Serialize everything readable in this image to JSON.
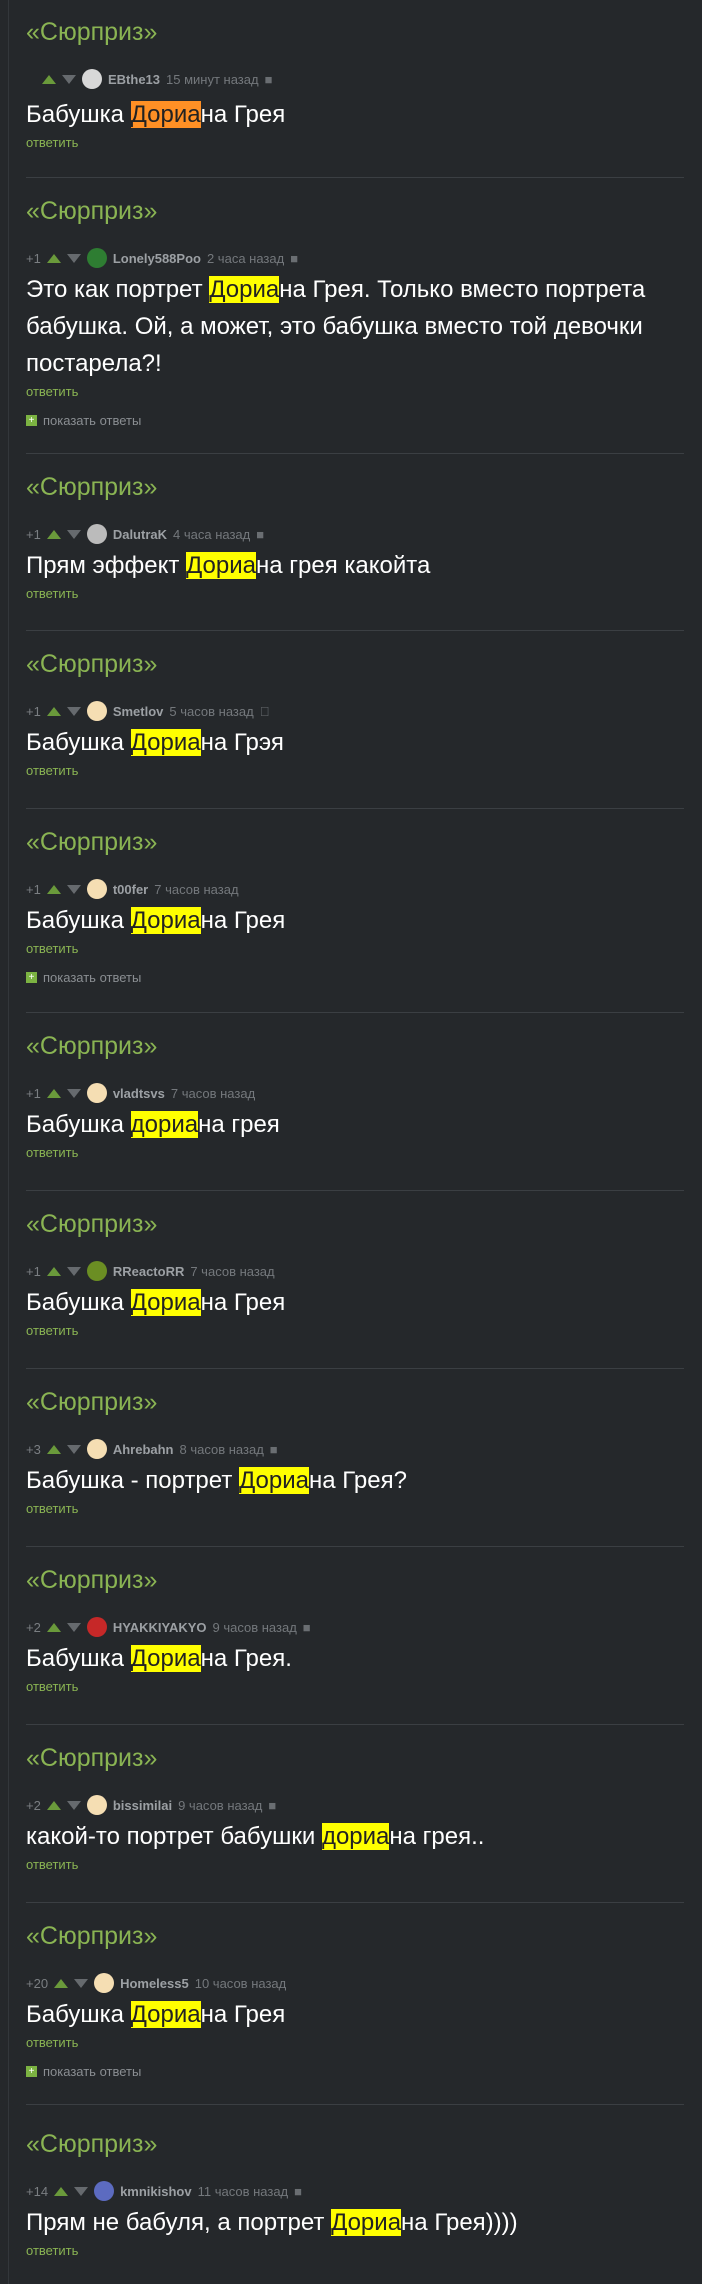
{
  "comments": [
    {
      "story": "«Сюрприз»",
      "rating": "",
      "author": "EBthe13",
      "time": "15 минут назад",
      "platform_icon": "android-icon",
      "pre": "Бабушка ",
      "hl": "Дориа",
      "post": "на Грея",
      "hl_color": "orange",
      "reply": "ответить",
      "show_replies": ""
    },
    {
      "story": "«Сюрприз»",
      "rating": "+1",
      "author": "Lonely588Poo",
      "time": "2 часа назад",
      "platform_icon": "android-icon",
      "pre": "Это как портрет ",
      "hl": "Дориа",
      "post": "на Грея. Только вместо портрета бабушка. Ой, а может, это бабушка вместо той девочки постарела?!",
      "hl_color": "yellow",
      "reply": "ответить",
      "show_replies": "показать ответы"
    },
    {
      "story": "«Сюрприз»",
      "rating": "+1",
      "author": "DalutraK",
      "time": "4 часа назад",
      "platform_icon": "android-icon",
      "pre": "Прям эффект ",
      "hl": "Дориа",
      "post": "на грея какойта",
      "hl_color": "yellow",
      "reply": "ответить",
      "show_replies": ""
    },
    {
      "story": "«Сюрприз»",
      "rating": "+1",
      "author": "Smetlov",
      "time": "5 часов назад",
      "platform_icon": "apple-icon",
      "pre": "Бабушка ",
      "hl": "Дориа",
      "post": "на Грэя",
      "hl_color": "yellow",
      "reply": "ответить",
      "show_replies": ""
    },
    {
      "story": "«Сюрприз»",
      "rating": "+1",
      "author": "t00fer",
      "time": "7 часов назад",
      "platform_icon": "",
      "pre": "Бабушка ",
      "hl": "Дориа",
      "post": "на Грея",
      "hl_color": "yellow",
      "reply": "ответить",
      "show_replies": "показать ответы"
    },
    {
      "story": "«Сюрприз»",
      "rating": "+1",
      "author": "vladtsvs",
      "time": "7 часов назад",
      "platform_icon": "",
      "pre": "Бабушка ",
      "hl": "дориа",
      "post": "на грея",
      "hl_color": "yellow",
      "reply": "ответить",
      "show_replies": ""
    },
    {
      "story": "«Сюрприз»",
      "rating": "+1",
      "author": "RReactoRR",
      "time": "7 часов назад",
      "platform_icon": "",
      "pre": "Бабушка ",
      "hl": "Дориа",
      "post": "на Грея",
      "hl_color": "yellow",
      "reply": "ответить",
      "show_replies": ""
    },
    {
      "story": "«Сюрприз»",
      "rating": "+3",
      "author": "Ahrebahn",
      "time": "8 часов назад",
      "platform_icon": "android-icon",
      "pre": "Бабушка - портрет ",
      "hl": "Дориа",
      "post": "на Грея?",
      "hl_color": "yellow",
      "reply": "ответить",
      "show_replies": ""
    },
    {
      "story": "«Сюрприз»",
      "rating": "+2",
      "author": "HYAKKIYAKYO",
      "time": "9 часов назад",
      "platform_icon": "android-icon",
      "pre": "Бабушка ",
      "hl": "Дориа",
      "post": "на Грея.",
      "hl_color": "yellow",
      "reply": "ответить",
      "show_replies": ""
    },
    {
      "story": "«Сюрприз»",
      "rating": "+2",
      "author": "bissimilai",
      "time": "9 часов назад",
      "platform_icon": "android-icon",
      "pre": "какой-то портрет бабушки ",
      "hl": "дориа",
      "post": "на грея..",
      "hl_color": "yellow",
      "reply": "ответить",
      "show_replies": ""
    },
    {
      "story": "«Сюрприз»",
      "rating": "+20",
      "author": "Homeless5",
      "time": "10 часов назад",
      "platform_icon": "",
      "pre": "Бабушка ",
      "hl": "Дориа",
      "post": "на Грея",
      "hl_color": "yellow",
      "reply": "ответить",
      "show_replies": "показать ответы"
    },
    {
      "story": "«Сюрприз»",
      "rating": "+14",
      "author": "kmnikishov",
      "time": "11 часов назад",
      "platform_icon": "android-icon",
      "pre": "Прям не бабуля, а портрет ",
      "hl": "Дориа",
      "post": "на Грея))))",
      "hl_color": "yellow",
      "reply": "ответить",
      "show_replies": ""
    }
  ],
  "avatar_colors": [
    "#d8d8d8",
    "#2e7d32",
    "#bbbbbb",
    "#f5deb3",
    "#f5deb3",
    "#f5deb3",
    "#6b8e23",
    "#f5deb3",
    "#c62828",
    "#f5deb3",
    "#f5deb3",
    "#5c6bc0"
  ]
}
